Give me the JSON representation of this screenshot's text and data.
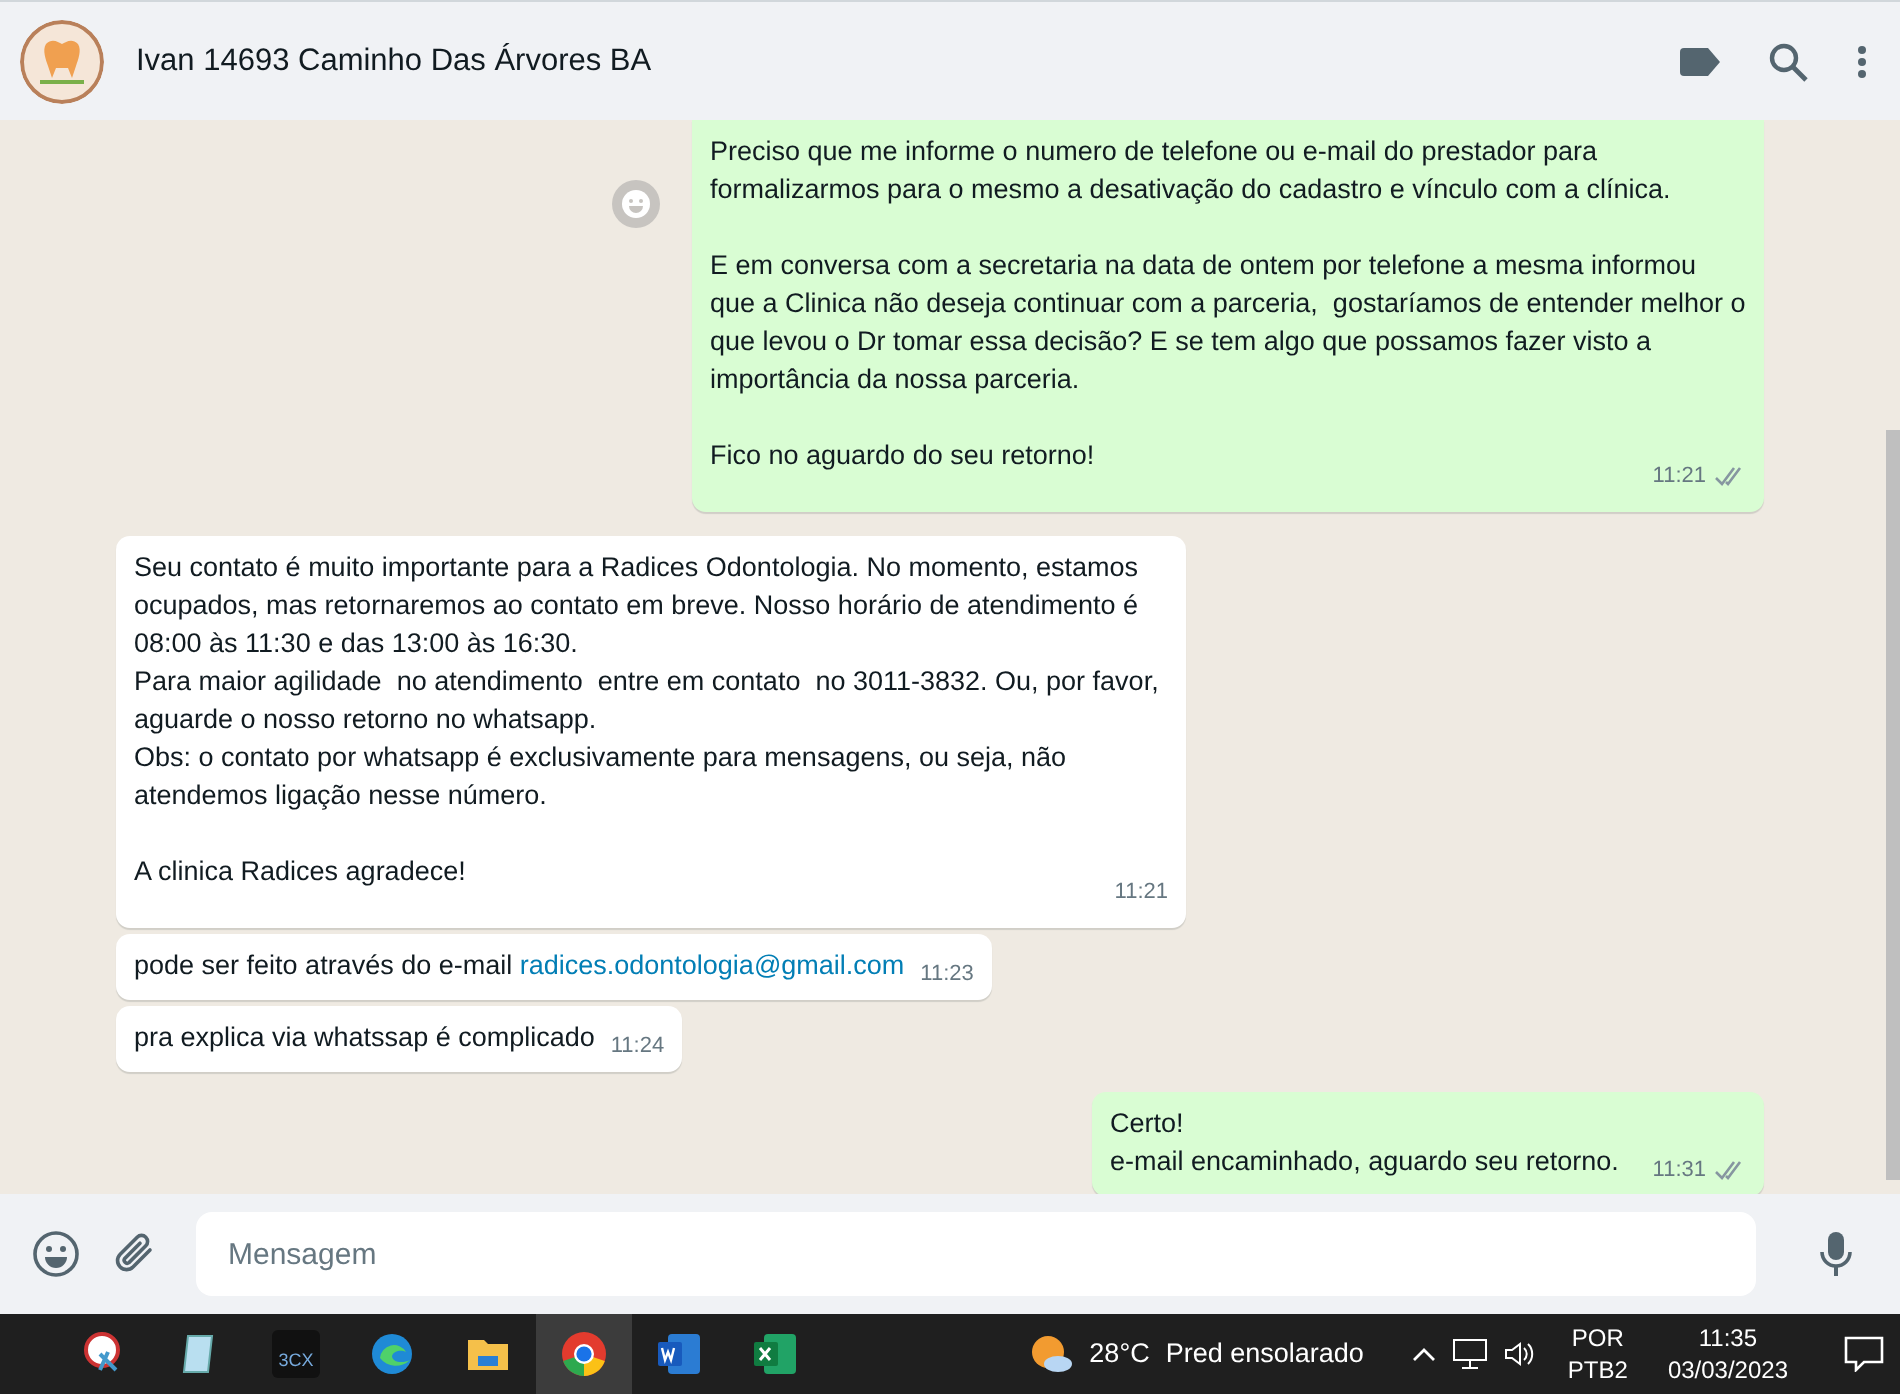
{
  "header": {
    "contact_name": "Ivan 14693 Caminho Das Árvores BA"
  },
  "messages": [
    {
      "kind": "outgoing",
      "text": "Preciso que me informe o numero de telefone ou e-mail do prestador para formalizarmos para o mesmo a desativação do cadastro e vínculo com a clínica.\n\nE em conversa com a secretaria na data de ontem por telefone a mesma informou que a Clinica não deseja continuar com a parceria,  gostaríamos de entender melhor o que levou o Dr tomar essa decisão? E se tem algo que possamos fazer visto a importância da nossa parceria.\n\nFico no aguardo do seu retorno!",
      "time": "11:21",
      "read": false
    },
    {
      "kind": "incoming",
      "text": "Seu contato é muito importante para a Radices Odontologia. No momento, estamos ocupados, mas retornaremos ao contato em breve. Nosso horário de atendimento é 08:00 às 11:30 e das 13:00 às 16:30.\nPara maior agilidade  no atendimento  entre em contato  no 3011-3832. Ou, por favor, aguarde o nosso retorno no whatsapp.\nObs: o contato por whatsapp é exclusivamente para mensagens, ou seja, não atendemos ligação nesse número.\n\nA clinica Radices agradece!",
      "time": "11:21"
    },
    {
      "kind": "incoming",
      "text": "pode ser feito através do e-mail ",
      "link": "radices.odontologia@gmail.com",
      "time": "11:23"
    },
    {
      "kind": "incoming",
      "text": "pra explica via whatssap é complicado",
      "time": "11:24"
    },
    {
      "kind": "outgoing",
      "text": "Certo!\ne-mail encaminhado, aguardo seu retorno.",
      "time": "11:31",
      "read": false
    }
  ],
  "composer": {
    "placeholder": "Mensagem"
  },
  "taskbar": {
    "apps": [
      {
        "kind": "snip",
        "selected": false
      },
      {
        "kind": "notepad",
        "selected": false
      },
      {
        "kind": "phone",
        "label": "3CX",
        "selected": false
      },
      {
        "kind": "edge",
        "selected": false
      },
      {
        "kind": "folder",
        "selected": false
      },
      {
        "kind": "chrome",
        "selected": true
      },
      {
        "kind": "word",
        "selected": false
      },
      {
        "kind": "excel",
        "selected": false
      }
    ],
    "weather": {
      "temperature": "28°C",
      "condition": "Pred ensolarado"
    },
    "language": [
      "POR",
      "PTB2"
    ],
    "time": "11:35",
    "date": "03/03/2023"
  }
}
